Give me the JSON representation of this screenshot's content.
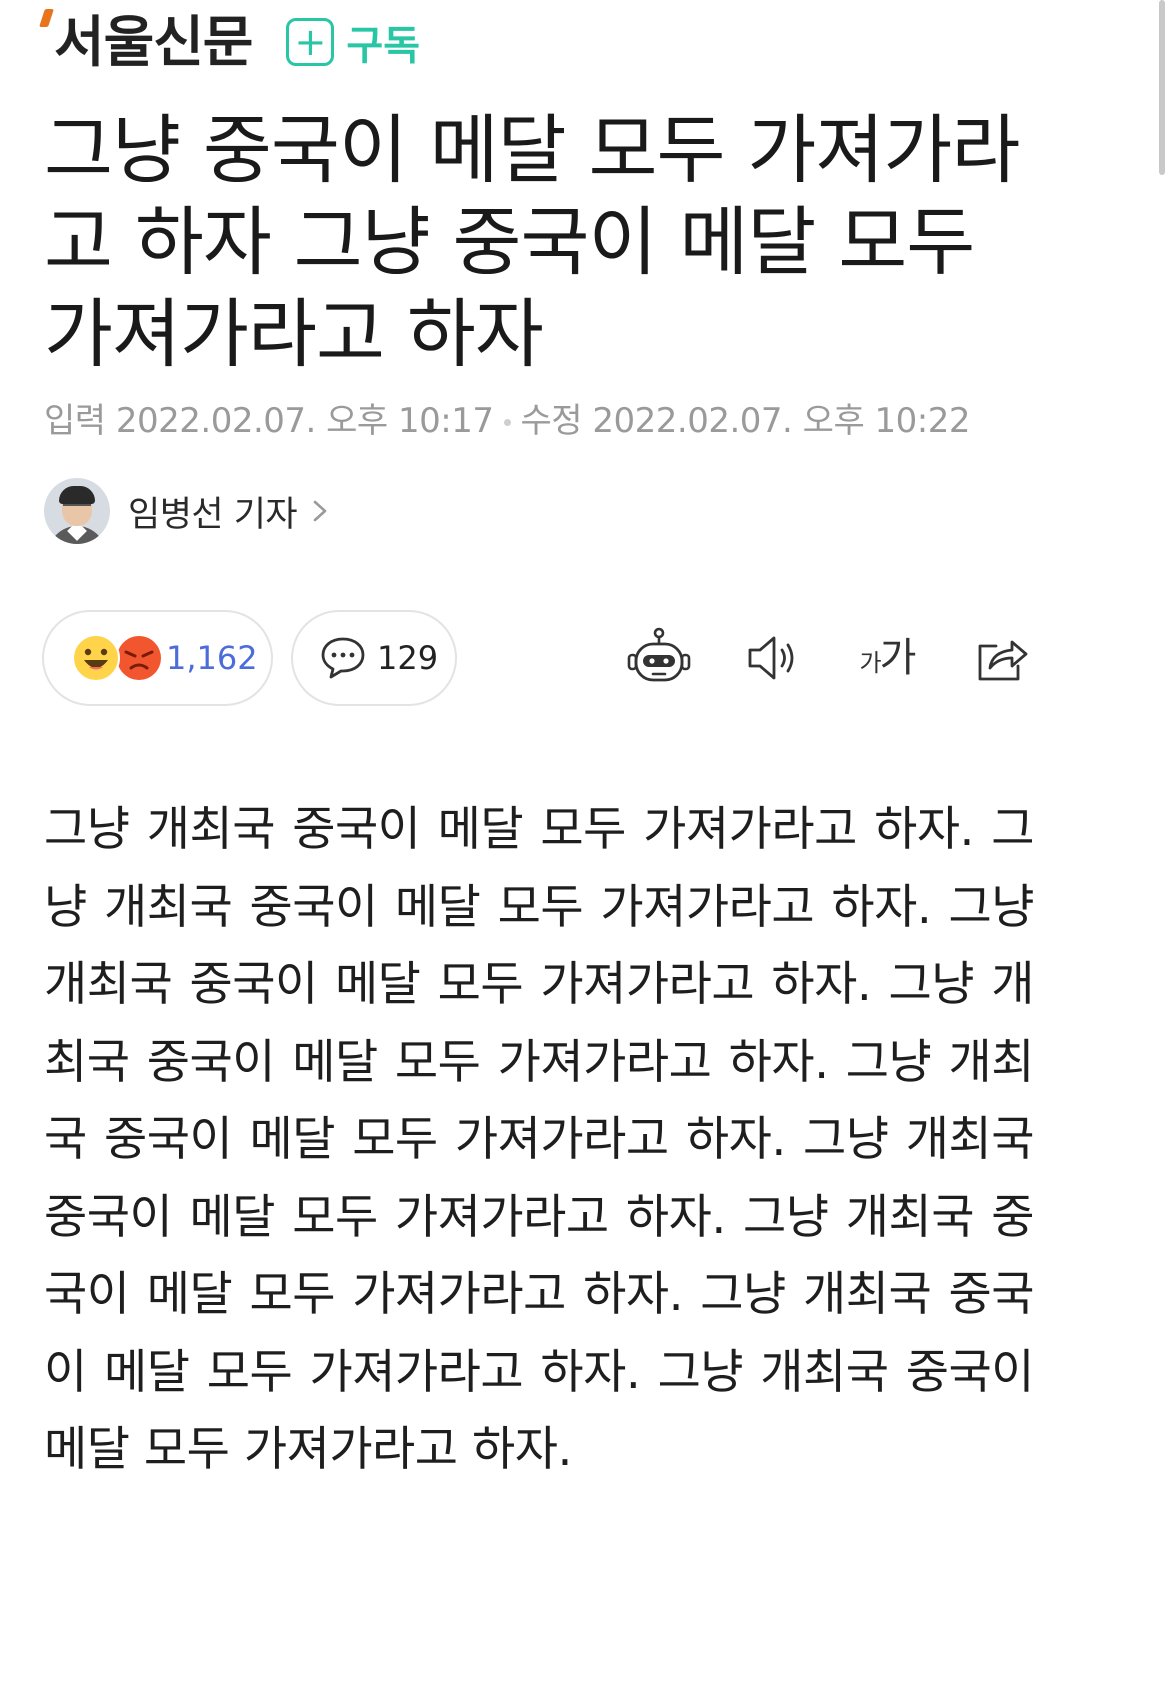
{
  "header": {
    "press_name": "서울신문",
    "subscribe_label": "구독",
    "subscribe_symbol": "+",
    "accent_color": "#29c6a5",
    "logo_mark_color": "#e8741e"
  },
  "article": {
    "headline": "그냥 중국이 메달 모두 가져가라고 하자 그냥 중국이 메달 모두 가져가라고 하자",
    "published": "입력 2022.02.07. 오후 10:17",
    "modified": "수정 2022.02.07. 오후 10:22",
    "reporter": "임병선 기자",
    "body": "그냥 개최국 중국이 메달 모두 가져가라고 하자. 그냥 개최국 중국이 메달 모두 가져가라고 하자. 그냥 개최국 중국이 메달 모두 가져가라고 하자. 그냥 개최국 중국이 메달 모두 가져가라고 하자. 그냥 개최국 중국이 메달 모두 가져가라고 하자. 그냥 개최국 중국이 메달 모두 가져가라고 하자. 그냥 개최국 중국이 메달 모두 가져가라고 하자. 그냥 개최국 중국이 메달 모두 가져가라고 하자. 그냥 개최국 중국이 메달 모두 가져가라고 하자."
  },
  "actions": {
    "reaction_count": "1,162",
    "comment_count": "129",
    "reaction_count_color": "#4c6cdc",
    "font_size_large": "가",
    "font_size_small": "가"
  },
  "icons": {
    "reactions": [
      "smile-emoji-icon",
      "angry-emoji-icon"
    ],
    "comment": "speech-bubble-icon",
    "summary": "robot-icon",
    "listen": "speaker-icon",
    "font_size": "font-size-icon",
    "share": "share-icon",
    "reporter_link": "chevron-right-icon"
  }
}
